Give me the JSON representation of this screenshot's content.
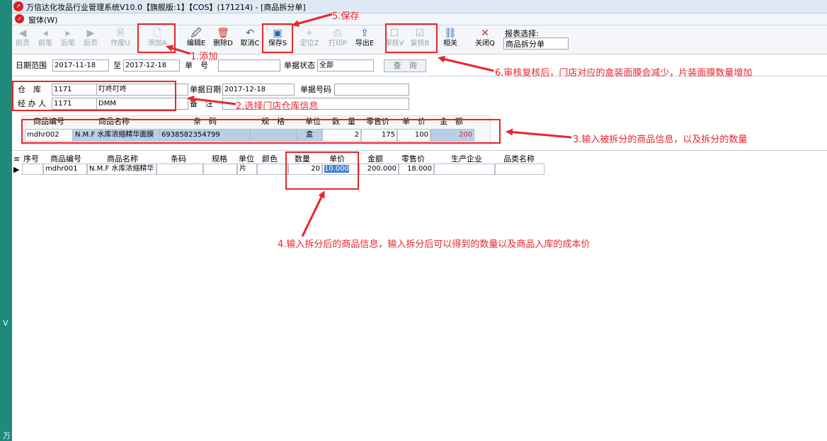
{
  "window": {
    "title": "万信达化妆品行业管理系统V10.0【旗舰版:1】【COS】(171214) - [商品拆分单]",
    "menu": "窗体(W)"
  },
  "toolbar": {
    "buttons": [
      {
        "label": "前页",
        "icon": "first-page-icon"
      },
      {
        "label": "前笔",
        "icon": "prev-icon"
      },
      {
        "label": "后笔",
        "icon": "next-icon"
      },
      {
        "label": "后页",
        "icon": "last-page-icon"
      },
      {
        "label": "作废U",
        "icon": "void-icon"
      },
      {
        "label": "添加A",
        "icon": "add-doc-icon"
      },
      {
        "label": "编辑E",
        "icon": "edit-icon"
      },
      {
        "label": "删除D",
        "icon": "delete-icon"
      },
      {
        "label": "取消C",
        "icon": "undo-icon"
      },
      {
        "label": "保存S",
        "icon": "save-icon"
      },
      {
        "label": "定位Z",
        "icon": "locate-icon"
      },
      {
        "label": "打印P",
        "icon": "print-icon"
      },
      {
        "label": "导出E",
        "icon": "export-icon"
      },
      {
        "label": "审核V",
        "icon": "approve-icon"
      },
      {
        "label": "复核B",
        "icon": "review-icon"
      },
      {
        "label": "相关",
        "icon": "link-icon"
      },
      {
        "label": "关闭Q",
        "icon": "close-icon"
      }
    ],
    "report_label": "报表选择:",
    "report_value": "商品拆分单"
  },
  "filter": {
    "date_range_label": "日期范围",
    "date_from": "2017-11-18",
    "to_label": "至",
    "date_to": "2017-12-18",
    "doc_no_label": "单　号",
    "doc_no": "",
    "status_label": "单据状态",
    "status": "全部",
    "query_label": "查　询"
  },
  "form": {
    "warehouse_label": "仓　库",
    "warehouse_code": "1171",
    "warehouse_name": "叮咚叮咚",
    "doc_date_label": "单据日期",
    "doc_date": "2017-12-18",
    "doc_code_label": "单据号码",
    "doc_code": "",
    "handler_label": "经 办 人",
    "handler_code": "1171",
    "handler_name": "DMM",
    "remark_label": "备　注",
    "remark": ""
  },
  "source_grid": {
    "headers": [
      "商品编号",
      "商品名称",
      "条　码",
      "规　格",
      "单位",
      "数　量",
      "零售价",
      "单　价",
      "金　额"
    ],
    "row": {
      "code": "mdhr002",
      "name": "N.M.F 水库浓缩精华面膜",
      "barcode": "6938582354799",
      "spec": "",
      "unit": "盒",
      "qty": "2",
      "retail": "175",
      "price": "100",
      "amount": "200"
    }
  },
  "detail_grid": {
    "headers": [
      "序号",
      "商品编号",
      "商品名称",
      "条码",
      "规格",
      "单位",
      "颜色",
      "数量",
      "单价",
      "金额",
      "零售价",
      "生产企业",
      "品类名称"
    ],
    "rows": [
      {
        "seq": "",
        "code": "mdhr001",
        "name": "N.M.F 水库浓缩精华",
        "barcode": "",
        "spec": "",
        "unit": "片",
        "color": "",
        "qty": "20",
        "price": "10.000",
        "amount": "200.000",
        "retail": "18.000",
        "maker": "",
        "category": ""
      }
    ]
  },
  "annotations": {
    "a1": "1.添加",
    "a2": "2.选择门店仓库信息",
    "a3": "3.输入被拆分的商品信息，以及拆分的数量",
    "a4": "4.输入拆分后的商品信息，输入拆分后可以得到的数量以及商品入库的成本价",
    "a5": "5.保存",
    "a6": "6.审核复核后，门店对应的盒装面膜会减少，片装面膜数量增加"
  },
  "colors": {
    "annotation": "#e8252b",
    "selection": "#b9cfe8",
    "amount_text": "#c8332c"
  },
  "side": {
    "glyph_v": "V",
    "glyph_wan": "万"
  }
}
